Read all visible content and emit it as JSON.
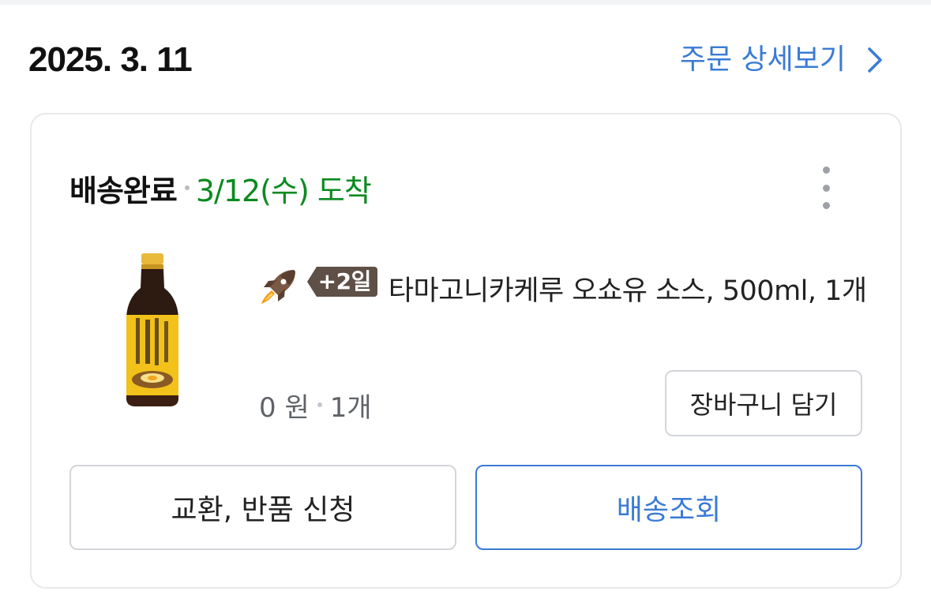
{
  "order": {
    "date": "2025. 3. 11",
    "detail_link": "주문 상세보기"
  },
  "shipment": {
    "status": "배송완료",
    "arrival": "3/12(수) 도착"
  },
  "product": {
    "delivery_badge": "+2일",
    "name": "타마고니카케루 오쇼유 소스, 500ml, 1개",
    "price": "0 원",
    "quantity": "1개",
    "cart_button": "장바구니 담기"
  },
  "actions": {
    "return_label": "교환, 반품 신청",
    "track_label": "배송조회"
  },
  "colors": {
    "accent": "#3a7bd5",
    "arrival_green": "#0a8a1f",
    "badge_brown": "#5e4f47"
  },
  "icons": [
    "chevron-right-icon",
    "more-vertical-icon",
    "rocket-icon",
    "product-image"
  ]
}
